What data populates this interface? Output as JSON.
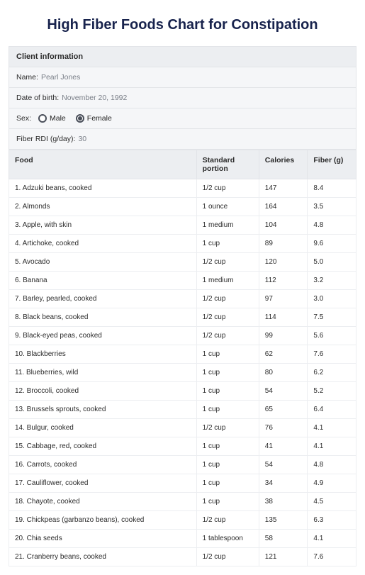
{
  "title": "High Fiber Foods Chart for Constipation",
  "client_section_header": "Client information",
  "client": {
    "name_label": "Name:",
    "name_value": "Pearl Jones",
    "dob_label": "Date of birth:",
    "dob_value": "November 20, 1992",
    "sex_label": "Sex:",
    "sex_options": {
      "male": "Male",
      "female": "Female"
    },
    "sex_selected": "female",
    "rdi_label": "Fiber RDI (g/day):",
    "rdi_value": "30"
  },
  "table_headers": {
    "food": "Food",
    "portion": "Standard portion",
    "calories": "Calories",
    "fiber": "Fiber (g)"
  },
  "chart_data": {
    "type": "table",
    "title": "High Fiber Foods Chart for Constipation",
    "columns": [
      "Food",
      "Standard portion",
      "Calories",
      "Fiber (g)"
    ],
    "rows": [
      {
        "n": 1,
        "food": "Adzuki beans, cooked",
        "portion": "1/2 cup",
        "calories": 147,
        "fiber": 8.4
      },
      {
        "n": 2,
        "food": "Almonds",
        "portion": "1 ounce",
        "calories": 164,
        "fiber": 3.5
      },
      {
        "n": 3,
        "food": "Apple, with skin",
        "portion": "1 medium",
        "calories": 104,
        "fiber": 4.8
      },
      {
        "n": 4,
        "food": "Artichoke, cooked",
        "portion": "1 cup",
        "calories": 89,
        "fiber": 9.6
      },
      {
        "n": 5,
        "food": "Avocado",
        "portion": "1/2 cup",
        "calories": 120,
        "fiber": 5.0
      },
      {
        "n": 6,
        "food": "Banana",
        "portion": "1 medium",
        "calories": 112,
        "fiber": 3.2
      },
      {
        "n": 7,
        "food": "Barley, pearled, cooked",
        "portion": "1/2 cup",
        "calories": 97,
        "fiber": 3.0
      },
      {
        "n": 8,
        "food": "Black beans, cooked",
        "portion": "1/2 cup",
        "calories": 114,
        "fiber": 7.5
      },
      {
        "n": 9,
        "food": "Black-eyed peas, cooked",
        "portion": "1/2 cup",
        "calories": 99,
        "fiber": 5.6
      },
      {
        "n": 10,
        "food": "Blackberries",
        "portion": "1 cup",
        "calories": 62,
        "fiber": 7.6
      },
      {
        "n": 11,
        "food": "Blueberries, wild",
        "portion": "1 cup",
        "calories": 80,
        "fiber": 6.2
      },
      {
        "n": 12,
        "food": "Broccoli, cooked",
        "portion": "1 cup",
        "calories": 54,
        "fiber": 5.2
      },
      {
        "n": 13,
        "food": "Brussels sprouts, cooked",
        "portion": "1 cup",
        "calories": 65,
        "fiber": 6.4
      },
      {
        "n": 14,
        "food": "Bulgur, cooked",
        "portion": "1/2 cup",
        "calories": 76,
        "fiber": 4.1
      },
      {
        "n": 15,
        "food": "Cabbage, red, cooked",
        "portion": "1 cup",
        "calories": 41,
        "fiber": 4.1
      },
      {
        "n": 16,
        "food": "Carrots, cooked",
        "portion": "1 cup",
        "calories": 54,
        "fiber": 4.8
      },
      {
        "n": 17,
        "food": "Cauliflower, cooked",
        "portion": "1 cup",
        "calories": 34,
        "fiber": 4.9
      },
      {
        "n": 18,
        "food": "Chayote, cooked",
        "portion": "1 cup",
        "calories": 38,
        "fiber": 4.5
      },
      {
        "n": 19,
        "food": "Chickpeas (garbanzo beans), cooked",
        "portion": "1/2 cup",
        "calories": 135,
        "fiber": 6.3
      },
      {
        "n": 20,
        "food": "Chia seeds",
        "portion": "1 tablespoon",
        "calories": 58,
        "fiber": 4.1
      },
      {
        "n": 21,
        "food": "Cranberry beans, cooked",
        "portion": "1/2 cup",
        "calories": 121,
        "fiber": 7.6
      }
    ]
  }
}
